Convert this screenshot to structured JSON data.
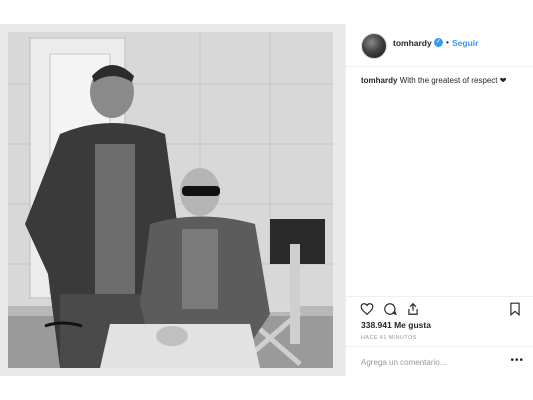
{
  "post": {
    "image_alt": "",
    "header": {
      "username": "tomhardy",
      "separator": "•",
      "follow_label": "Seguir"
    },
    "caption": {
      "username": "tomhardy",
      "text": "With the greatest of respect ❤"
    },
    "likes": "338.941 Me gusta",
    "time_ago": "HACE 41 MINUTOS",
    "comment": {
      "placeholder": "Agrega un comentario...",
      "more_label": "•••"
    },
    "icons": {
      "like": "heart-icon",
      "comment": "comment-bubble-icon",
      "share": "share-icon",
      "save": "bookmark-icon",
      "verified": "verified-badge-icon"
    },
    "colors": {
      "accent": "#3897f0",
      "text": "#262626",
      "muted": "#999999",
      "border": "#efefef"
    }
  }
}
